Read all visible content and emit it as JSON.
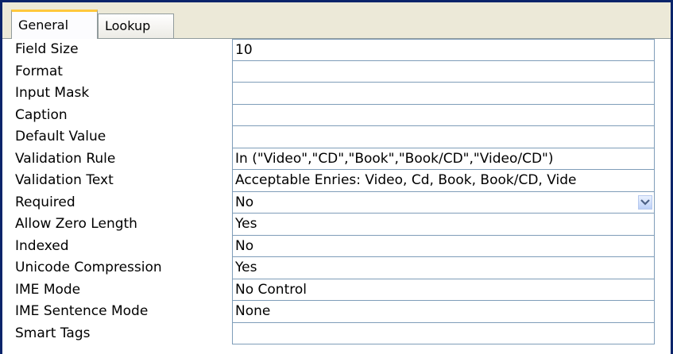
{
  "tabs": [
    {
      "label": "General"
    },
    {
      "label": "Lookup"
    }
  ],
  "properties": [
    {
      "label": "Field Size",
      "value": "10"
    },
    {
      "label": "Format",
      "value": ""
    },
    {
      "label": "Input Mask",
      "value": ""
    },
    {
      "label": "Caption",
      "value": ""
    },
    {
      "label": "Default Value",
      "value": ""
    },
    {
      "label": "Validation Rule",
      "value": "In (\"Video\",\"CD\",\"Book\",\"Book/CD\",\"Video/CD\")"
    },
    {
      "label": "Validation Text",
      "value": "Acceptable Enries: Video, Cd, Book, Book/CD, Vide"
    },
    {
      "label": "Required",
      "value": "No"
    },
    {
      "label": "Allow Zero Length",
      "value": "Yes"
    },
    {
      "label": "Indexed",
      "value": "No"
    },
    {
      "label": "Unicode Compression",
      "value": "Yes"
    },
    {
      "label": "IME Mode",
      "value": "No Control"
    },
    {
      "label": "IME Sentence Mode",
      "value": "None"
    },
    {
      "label": "Smart Tags",
      "value": ""
    }
  ],
  "colors": {
    "border": "#7f9db9",
    "active_tab_accent": "#ffc83c",
    "window_border": "#0a246a"
  }
}
